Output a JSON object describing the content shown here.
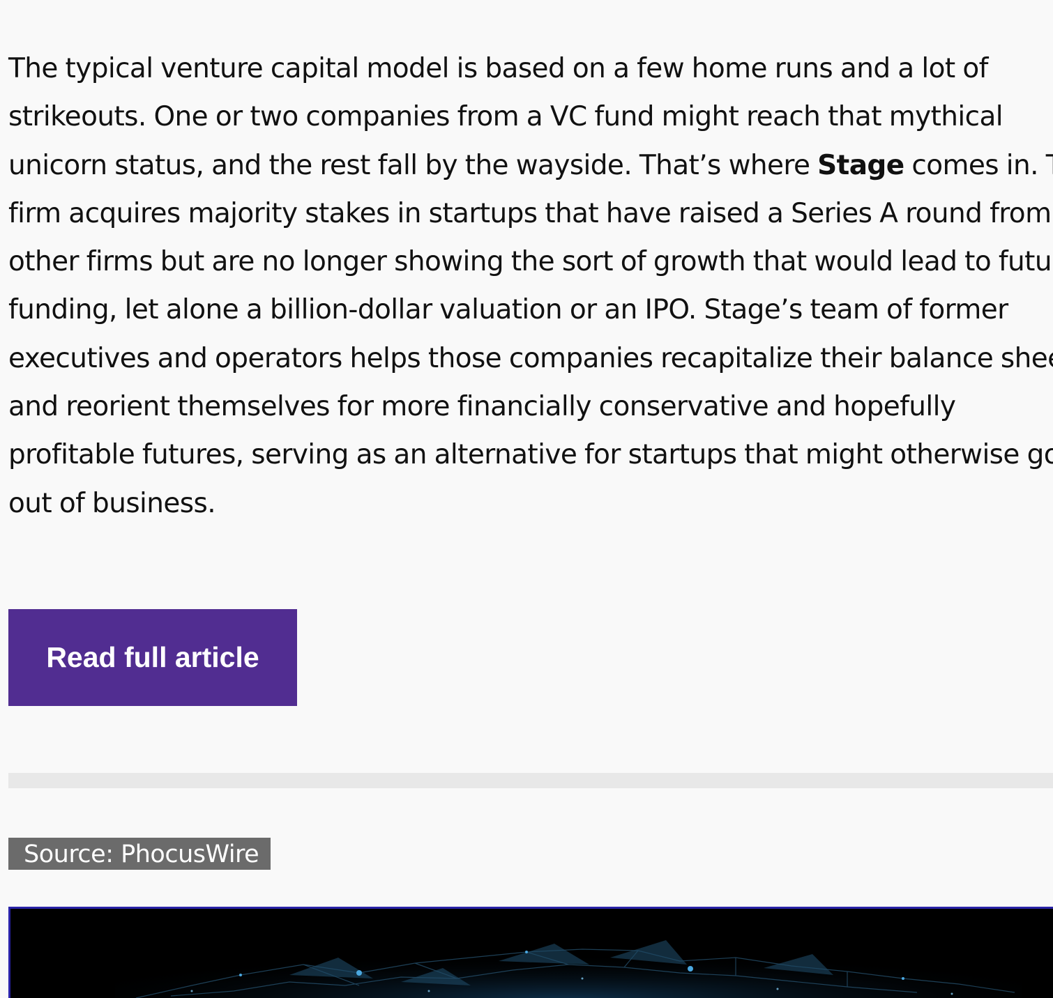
{
  "article": {
    "lines": [
      "The typical venture capital model is based on a few home runs and a lot of",
      "strikeouts. One or two companies from a VC fund might reach that mythical",
      "unicorn status, and the rest fall by the wayside. That’s where ",
      "Stage",
      " comes in. The",
      "firm acquires majority stakes in startups that have raised a Series A round from",
      "other firms but are no longer showing the sort of growth that would lead to future",
      "funding, let alone a billion-dollar valuation or an IPO. Stage’s team of former",
      "executives and operators helps those companies recapitalize their balance sheets",
      "and reorient themselves for more financially conservative and hopefully",
      "profitable futures, serving as an alternative for startups that might otherwise go",
      "out of business."
    ]
  },
  "cta": {
    "label": "Read full article",
    "color": "#512d91"
  },
  "source": {
    "label": "Source: PhocusWire"
  },
  "hero_image": {
    "description_icon": "network-graphic"
  }
}
